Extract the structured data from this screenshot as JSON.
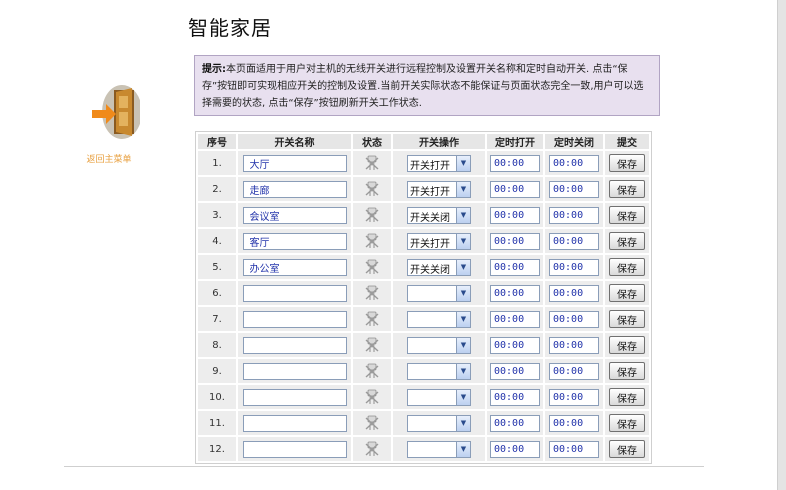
{
  "page": {
    "title": "智能家居"
  },
  "tip": {
    "label": "提示:",
    "text": "本页面适用于用户对主机的无线开关进行远程控制及设置开关名称和定时自动开关. 点击“保存”按钮即可实现相应开关的控制及设置.当前开关实际状态不能保证与页面状态完全一致,用户可以选择需要的状态, 点击“保存”按钮刷新开关工作状态."
  },
  "back": {
    "label": "返回主菜单",
    "icon": "door-exit-icon"
  },
  "table": {
    "headers": [
      "序号",
      "开关名称",
      "状态",
      "开关操作",
      "定时打开",
      "定时关闭",
      "提交"
    ],
    "rows": [
      {
        "no": "1.",
        "name": "大厅",
        "op": "开关打开",
        "on": "00:00",
        "off": "00:00",
        "submit": "保存"
      },
      {
        "no": "2.",
        "name": "走廊",
        "op": "开关打开",
        "on": "00:00",
        "off": "00:00",
        "submit": "保存"
      },
      {
        "no": "3.",
        "name": "会议室",
        "op": "开关关闭",
        "on": "00:00",
        "off": "00:00",
        "submit": "保存"
      },
      {
        "no": "4.",
        "name": "客厅",
        "op": "开关打开",
        "on": "00:00",
        "off": "00:00",
        "submit": "保存"
      },
      {
        "no": "5.",
        "name": "办公室",
        "op": "开关关闭",
        "on": "00:00",
        "off": "00:00",
        "submit": "保存"
      },
      {
        "no": "6.",
        "name": "",
        "op": "",
        "on": "00:00",
        "off": "00:00",
        "submit": "保存"
      },
      {
        "no": "7.",
        "name": "",
        "op": "",
        "on": "00:00",
        "off": "00:00",
        "submit": "保存"
      },
      {
        "no": "8.",
        "name": "",
        "op": "",
        "on": "00:00",
        "off": "00:00",
        "submit": "保存"
      },
      {
        "no": "9.",
        "name": "",
        "op": "",
        "on": "00:00",
        "off": "00:00",
        "submit": "保存"
      },
      {
        "no": "10.",
        "name": "",
        "op": "",
        "on": "00:00",
        "off": "00:00",
        "submit": "保存"
      },
      {
        "no": "11.",
        "name": "",
        "op": "",
        "on": "00:00",
        "off": "00:00",
        "submit": "保存"
      },
      {
        "no": "12.",
        "name": "",
        "op": "",
        "on": "00:00",
        "off": "00:00",
        "submit": "保存"
      }
    ]
  },
  "colors": {
    "tip_bg": "#e8e0ef",
    "tip_border": "#b1a4c3",
    "back_label": "#e8a040",
    "input_text": "#2233aa",
    "header_bg": "#e6e6e6",
    "cell_bg": "#ededed"
  },
  "icons": {
    "state": "plug-off-icon",
    "dropdown": "chevron-down-icon"
  }
}
